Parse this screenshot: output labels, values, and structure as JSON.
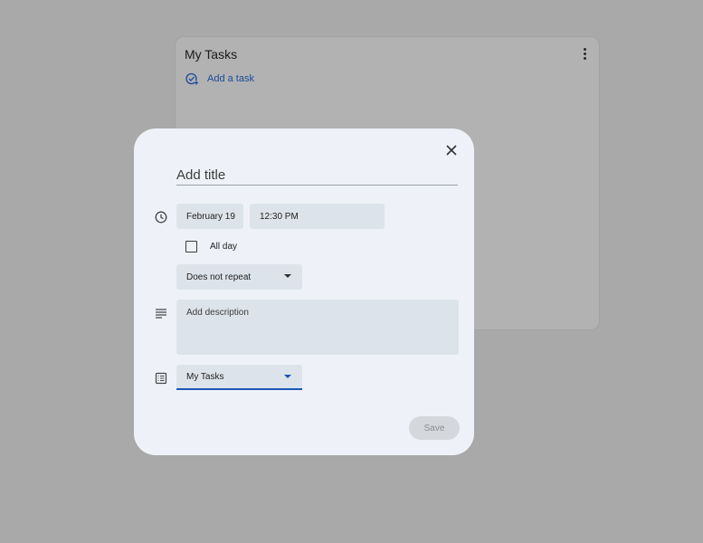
{
  "panel": {
    "title": "My Tasks",
    "more_icon": "more-vert-icon",
    "add_task_label": "Add a task",
    "add_task_icon": "add-task-icon"
  },
  "dialog": {
    "close_icon": "close-icon",
    "title_placeholder": "Add title",
    "date": "February 19",
    "time": "12:30 PM",
    "all_day_label": "All day",
    "all_day_checked": false,
    "repeat_value": "Does not repeat",
    "description_placeholder": "Add description",
    "list_value": "My Tasks",
    "save_label": "Save",
    "icons": {
      "time": "clock-icon",
      "description": "notes-icon",
      "list": "list-icon"
    }
  },
  "colors": {
    "overlay": "#a9a9a9",
    "dialog_bg": "#eef2f8",
    "field_bg": "#dde3ea",
    "accent": "#1a57b8",
    "link": "#1a4b9a"
  }
}
